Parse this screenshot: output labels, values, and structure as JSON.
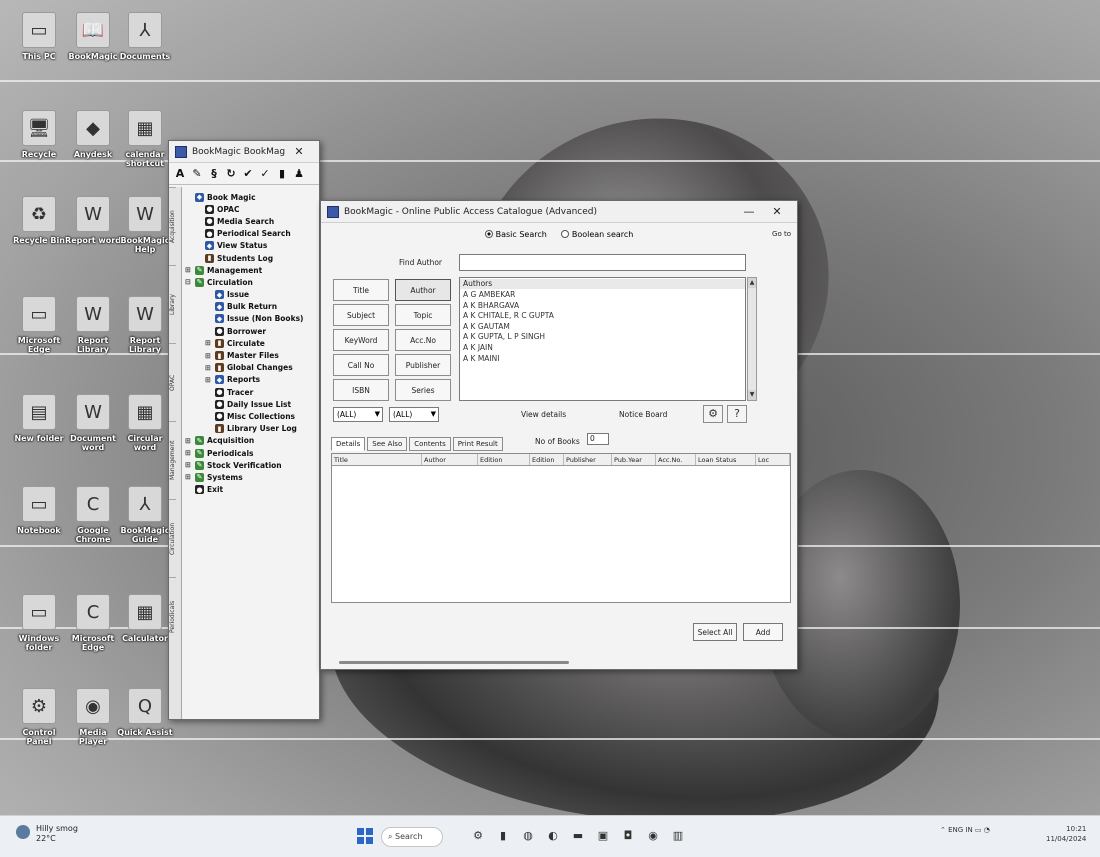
{
  "desktop": {
    "icons": [
      {
        "label": "This PC",
        "glyph": "▭"
      },
      {
        "label": "BookMagic",
        "glyph": "📖"
      },
      {
        "label": "Documents",
        "glyph": "⅄"
      },
      {
        "label": "Recycle",
        "glyph": "🖥"
      },
      {
        "label": "Anydesk",
        "glyph": "◆"
      },
      {
        "label": "calendar shortcut",
        "glyph": "▦"
      },
      {
        "label": "Recycle Bin",
        "glyph": "♻"
      },
      {
        "label": "Report word",
        "glyph": "W"
      },
      {
        "label": "BookMagic Help",
        "glyph": "W"
      },
      {
        "label": "Microsoft Edge",
        "glyph": "▭"
      },
      {
        "label": "Report Library",
        "glyph": "W"
      },
      {
        "label": "Report Library",
        "glyph": "W"
      },
      {
        "label": "New folder",
        "glyph": "▤"
      },
      {
        "label": "Document word",
        "glyph": "W"
      },
      {
        "label": "Circular word",
        "glyph": "▦"
      },
      {
        "label": "Notebook",
        "glyph": "▭"
      },
      {
        "label": "Google Chrome",
        "glyph": "C"
      },
      {
        "label": "BookMagic Guide",
        "glyph": "⅄"
      },
      {
        "label": "Windows folder",
        "glyph": "▭"
      },
      {
        "label": "Microsoft Edge",
        "glyph": "C"
      },
      {
        "label": "Calculator",
        "glyph": "▦"
      },
      {
        "label": "Control Panel",
        "glyph": "⚙"
      },
      {
        "label": "Media Player",
        "glyph": "◉"
      },
      {
        "label": "Quick Assist",
        "glyph": "Q"
      }
    ]
  },
  "main_window": {
    "title": "BookMagic BookMagic",
    "toolbar_icons": [
      "A",
      "✎",
      "§",
      "↻",
      "✔",
      "✓",
      "▮",
      "♟"
    ],
    "side_tabs": [
      "Acquisition",
      "Library",
      "OPAC",
      "Management",
      "Circulation",
      "Periodicals"
    ],
    "tree": [
      {
        "label": "Book Magic",
        "icon": "blue",
        "indent": 0,
        "exp": ""
      },
      {
        "label": "OPAC",
        "icon": "dark",
        "indent": 1,
        "exp": ""
      },
      {
        "label": "Media Search",
        "icon": "dark",
        "indent": 1,
        "exp": ""
      },
      {
        "label": "Periodical Search",
        "icon": "dark",
        "indent": 1,
        "exp": ""
      },
      {
        "label": "View Status",
        "icon": "blue",
        "indent": 1,
        "exp": ""
      },
      {
        "label": "Students Log",
        "icon": "book",
        "indent": 1,
        "exp": ""
      },
      {
        "label": "Management",
        "icon": "green",
        "indent": 0,
        "exp": "⊞"
      },
      {
        "label": "Circulation",
        "icon": "green",
        "indent": 0,
        "exp": "⊟"
      },
      {
        "label": "Issue",
        "icon": "blue",
        "indent": 2,
        "exp": ""
      },
      {
        "label": "Bulk Return",
        "icon": "blue",
        "indent": 2,
        "exp": ""
      },
      {
        "label": "Issue (Non Books)",
        "icon": "blue",
        "indent": 2,
        "exp": ""
      },
      {
        "label": "Borrower",
        "icon": "dark",
        "indent": 2,
        "exp": ""
      },
      {
        "label": "Circulate",
        "icon": "book",
        "indent": 2,
        "exp": "⊞"
      },
      {
        "label": "Master Files",
        "icon": "book",
        "indent": 2,
        "exp": "⊞"
      },
      {
        "label": "Global Changes",
        "icon": "book",
        "indent": 2,
        "exp": "⊞"
      },
      {
        "label": "Reports",
        "icon": "blue",
        "indent": 2,
        "exp": "⊞"
      },
      {
        "label": "Tracer",
        "icon": "dark",
        "indent": 2,
        "exp": ""
      },
      {
        "label": "Daily Issue List",
        "icon": "dark",
        "indent": 2,
        "exp": ""
      },
      {
        "label": "Misc Collections",
        "icon": "dark",
        "indent": 2,
        "exp": ""
      },
      {
        "label": "Library User Log",
        "icon": "book",
        "indent": 2,
        "exp": ""
      },
      {
        "label": "Acquisition",
        "icon": "green",
        "indent": 0,
        "exp": "⊞"
      },
      {
        "label": "Periodicals",
        "icon": "green",
        "indent": 0,
        "exp": "⊞"
      },
      {
        "label": "Stock Verification",
        "icon": "green",
        "indent": 0,
        "exp": "⊞"
      },
      {
        "label": "Systems",
        "icon": "green",
        "indent": 0,
        "exp": "⊞"
      },
      {
        "label": "Exit",
        "icon": "dark",
        "indent": 0,
        "exp": ""
      }
    ]
  },
  "opac": {
    "title": "BookMagic - Online Public Access Catalogue (Advanced)",
    "minimize": "—",
    "close": "✕",
    "search_mode": {
      "basic": "Basic Search",
      "boolean": "Boolean search",
      "goto": "Go to"
    },
    "find_label": "Find Author",
    "find_value": "",
    "field_buttons": [
      {
        "label": "Title"
      },
      {
        "label": "Author"
      },
      {
        "label": "Subject"
      },
      {
        "label": "Topic"
      },
      {
        "label": "KeyWord"
      },
      {
        "label": "Acc.No"
      },
      {
        "label": "Call No"
      },
      {
        "label": "Publisher"
      },
      {
        "label": "ISBN"
      },
      {
        "label": "Series"
      }
    ],
    "list_header": "Authors",
    "authors": [
      "A G AMBEKAR",
      "A K BHARGAVA",
      "A K CHITALE, R C GUPTA",
      "A K GAUTAM",
      "A K GUPTA, L P SINGH",
      "A K JAIN",
      "A K MAINI"
    ],
    "filter1": "(ALL)",
    "filter2": "(ALL)",
    "view_details": "View details",
    "notice_board": "Notice Board",
    "tabs": [
      "Details",
      "See Also",
      "Contents",
      "Print Result"
    ],
    "no_of_books_label": "No of Books",
    "no_of_books_value": "0",
    "columns": [
      "Title",
      "Author",
      "Edition",
      "Edition",
      "Publisher",
      "Pub.Year",
      "Acc.No.",
      "Loan Status",
      "Loc"
    ],
    "select_all": "Select All",
    "add": "Add"
  },
  "taskbar": {
    "weather": "Hilly smog",
    "weather_temp": "22°C",
    "search": "Search",
    "tray": "ENG IN",
    "time": "10:21",
    "date": "11/04/2024"
  }
}
